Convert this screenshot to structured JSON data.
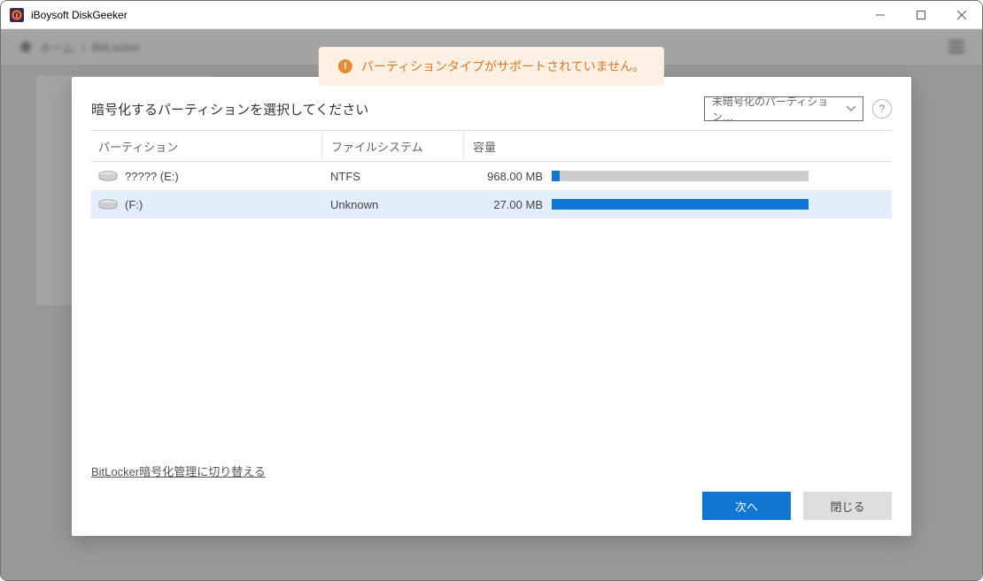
{
  "window": {
    "title": "iBoysoft DiskGeeker"
  },
  "background": {
    "breadcrumb_home": "ホーム",
    "breadcrumb_sep": "›",
    "breadcrumb_current": "BitLocker"
  },
  "toast": {
    "icon_glyph": "!",
    "message": "パーティションタイプがサポートされていません。"
  },
  "modal": {
    "title": "暗号化するパーティションを選択してください",
    "filter_label": "未暗号化のパーティション…",
    "help_glyph": "?",
    "columns": {
      "name": "パーティション",
      "fs": "ファイルシステム",
      "capacity": "容量"
    },
    "rows": [
      {
        "name": "????? (E:)",
        "fs": "NTFS",
        "capacity": "968.00 MB",
        "fill_pct": 3,
        "selected": false
      },
      {
        "name": "(F:)",
        "fs": "Unknown",
        "capacity": "27.00 MB",
        "fill_pct": 100,
        "selected": true
      }
    ],
    "link": "BitLocker暗号化管理に切り替える",
    "next": "次へ",
    "close": "閉じる"
  }
}
